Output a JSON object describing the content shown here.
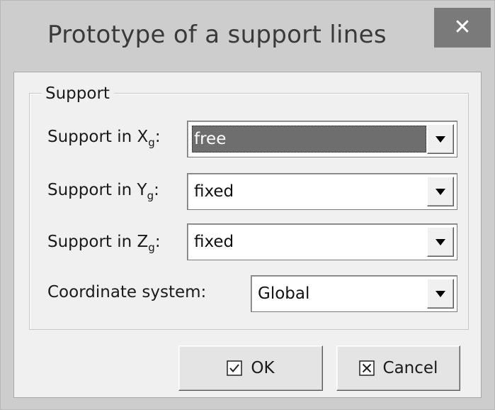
{
  "window": {
    "title": "Prototype of a support lines",
    "close_glyph": "✕"
  },
  "group": {
    "legend": "Support",
    "rows": [
      {
        "label_main": "Support in X",
        "label_sub": "g",
        "label_suffix": ":",
        "value": "free",
        "selected": true
      },
      {
        "label_main": "Support in Y",
        "label_sub": "g",
        "label_suffix": ":",
        "value": "fixed",
        "selected": false
      },
      {
        "label_main": "Support in Z",
        "label_sub": "g",
        "label_suffix": ":",
        "value": "fixed",
        "selected": false
      }
    ],
    "coordinate": {
      "label": "Coordinate system:",
      "value": "Global"
    }
  },
  "buttons": {
    "ok_label": "OK",
    "cancel_label": "Cancel"
  },
  "icons": {
    "close": "close-icon",
    "dropdown": "triangle-down-icon",
    "ok": "checkbox-checked-icon",
    "cancel": "checkbox-x-icon"
  },
  "colors": {
    "titlebar": "#cdcdcd",
    "close_button": "#7a7a7a",
    "client_bg": "#f0f0f0",
    "selection": "#6e6e6e"
  }
}
